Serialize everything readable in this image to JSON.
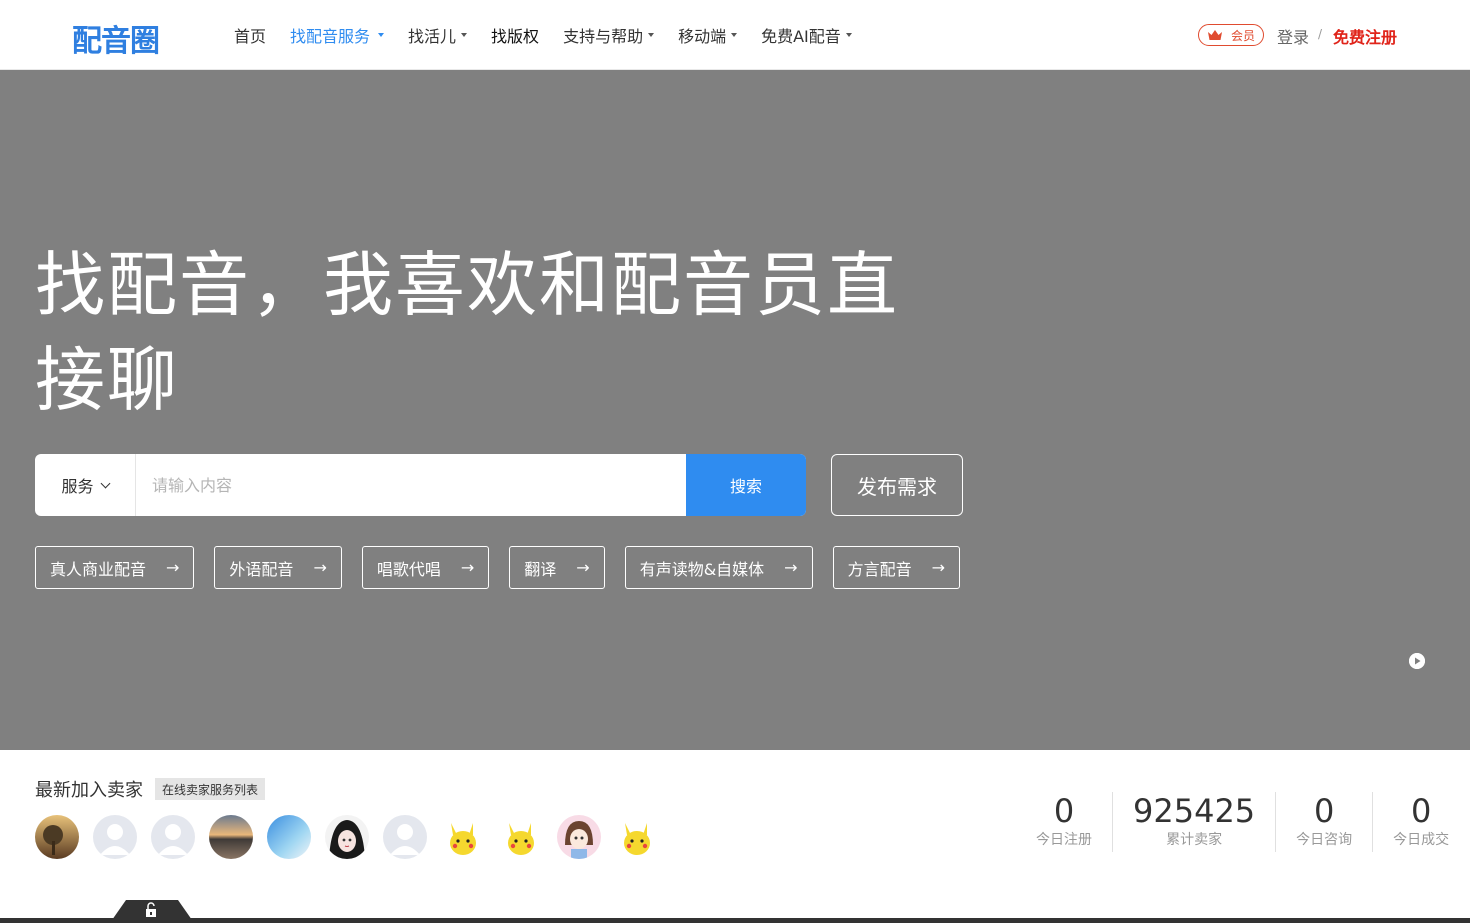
{
  "header": {
    "logo_text": "配音圈",
    "nav": [
      {
        "label": "首页",
        "dropdown": false,
        "active": false
      },
      {
        "label": "找配音服务",
        "dropdown": true,
        "active": true
      },
      {
        "label": "找活儿",
        "dropdown": true,
        "active": false
      },
      {
        "label": "找版权",
        "dropdown": false,
        "active": false
      },
      {
        "label": "支持与帮助",
        "dropdown": true,
        "active": false
      },
      {
        "label": "移动端",
        "dropdown": true,
        "active": false
      },
      {
        "label": "免费AI配音",
        "dropdown": true,
        "active": false
      }
    ],
    "member_label": "会员",
    "login_label": "登录",
    "separator": "/",
    "register_label": "免费注册"
  },
  "hero": {
    "title": "找配音，我喜欢和配音员直接聊",
    "search": {
      "select_value": "服务",
      "placeholder": "请输入内容",
      "button_label": "搜索"
    },
    "publish_label": "发布需求",
    "tags": [
      {
        "label": "真人商业配音",
        "arrow": "→"
      },
      {
        "label": "外语配音",
        "arrow": "→"
      },
      {
        "label": "唱歌代唱",
        "arrow": "→"
      },
      {
        "label": "翻译",
        "arrow": "→"
      },
      {
        "label": "有声读物&自媒体",
        "arrow": "→"
      },
      {
        "label": "方言配音",
        "arrow": "→"
      }
    ]
  },
  "sellers": {
    "title": "最新加入卖家",
    "link_label": "在线卖家服务列表",
    "avatars": [
      "tree-sunset",
      "default-user",
      "default-user",
      "sunset-sea",
      "beach",
      "anime-girl",
      "default-user",
      "pikachu",
      "pikachu",
      "anime-girl-2",
      "pikachu"
    ]
  },
  "stats": [
    {
      "value": "0",
      "label": "今日注册"
    },
    {
      "value": "925425",
      "label": "累计卖家"
    },
    {
      "value": "0",
      "label": "今日咨询"
    },
    {
      "value": "0",
      "label": "今日成交"
    }
  ],
  "colors": {
    "accent": "#2f8cf0",
    "register": "#e0241a",
    "hero_bg": "#808080"
  }
}
